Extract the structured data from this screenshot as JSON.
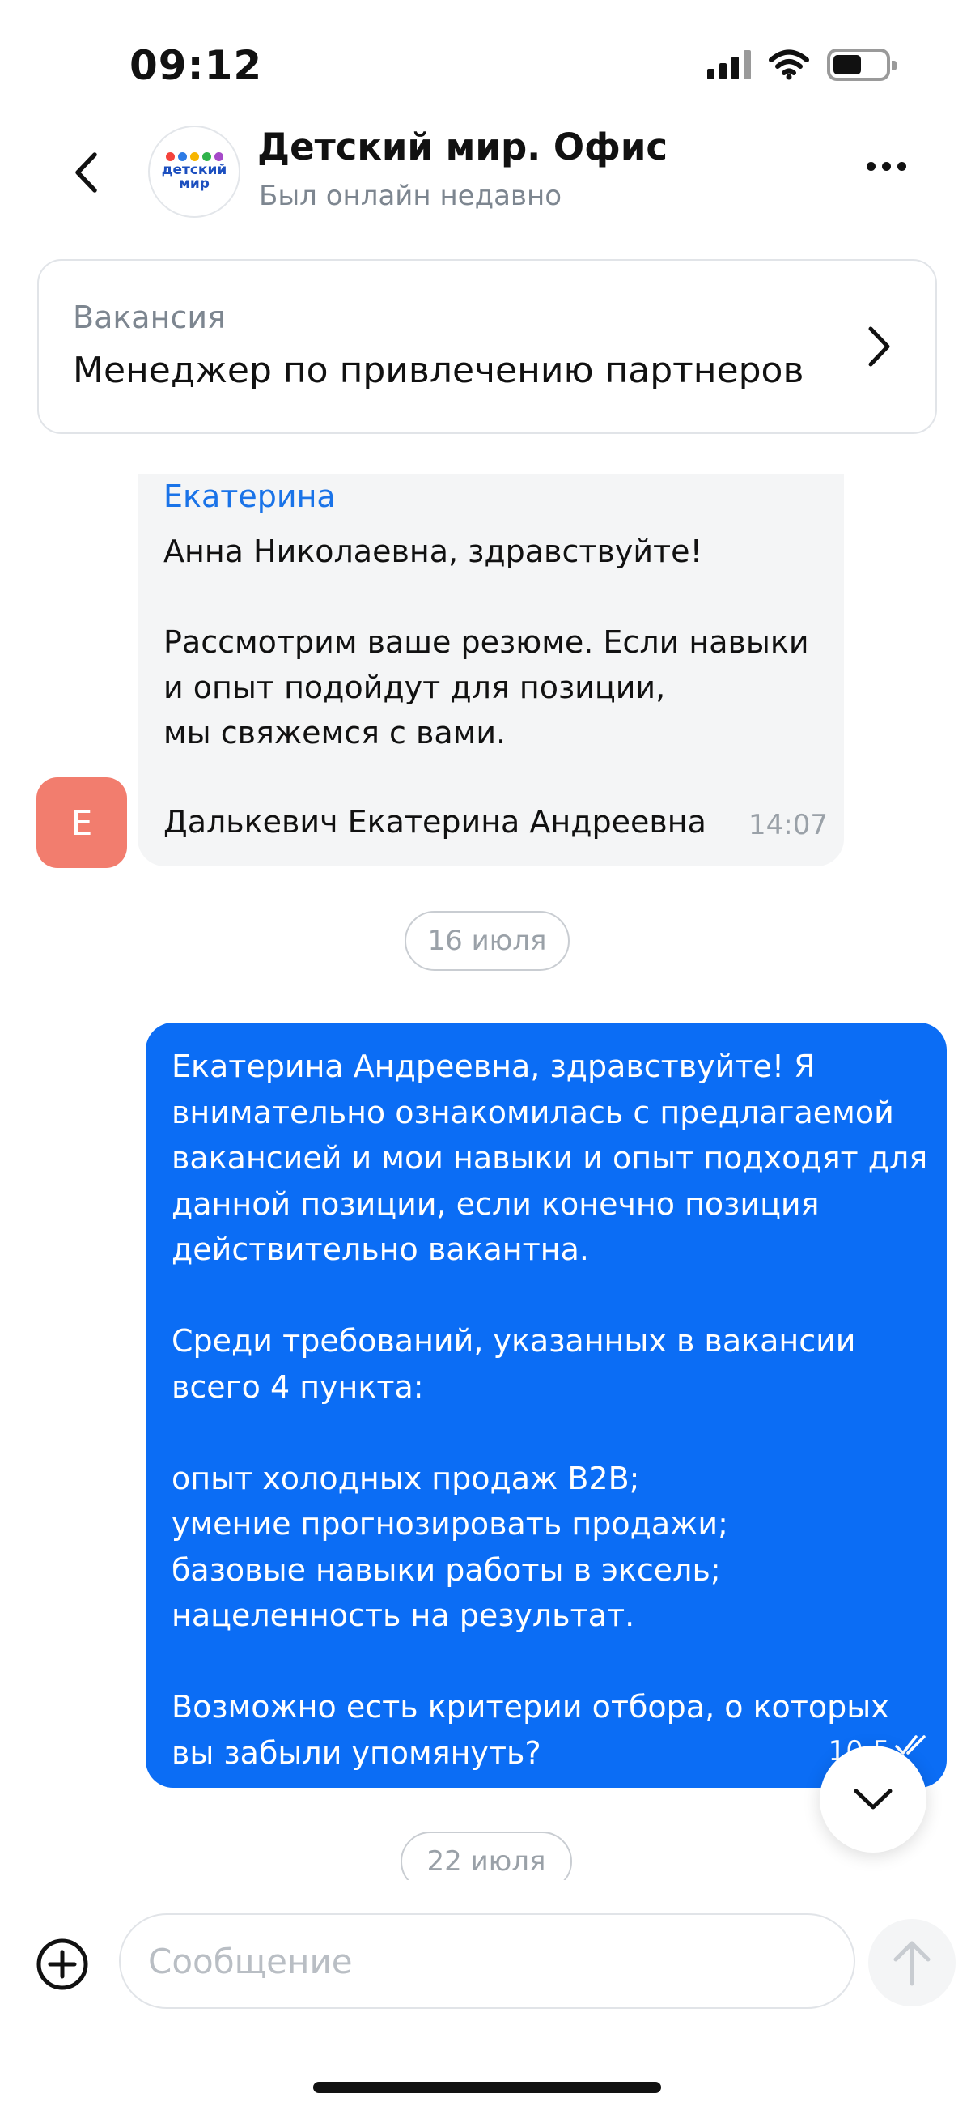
{
  "status_bar": {
    "time": "09:12",
    "icons": [
      "signal-icon",
      "wifi-icon",
      "battery-icon"
    ]
  },
  "header": {
    "title": "Детский мир. Офис",
    "subtitle": "Был онлайн недавно",
    "logo": {
      "text_line1": "детский",
      "text_line2": "мир",
      "dot_colors": [
        "#f4433c",
        "#2d7be5",
        "#f7b500",
        "#2fb34a",
        "#a64ac9"
      ]
    },
    "icons": [
      "back-icon",
      "more-icon"
    ]
  },
  "vacancy": {
    "label": "Вакансия",
    "title": "Менеджер по привлечению партнеров"
  },
  "messages": {
    "incoming": {
      "sender": "Екатерина",
      "avatar_letter": "Е",
      "avatar_color": "#f27d6e",
      "text": "Анна Николаевна, здравствуйте!\n\nРассмотрим ваше резюме. Если навыки\nи опыт подойдут для позиции,\nмы свяжемся с вами.",
      "signature": "Далькевич Екатерина Андреевна",
      "time": "14:07"
    },
    "date_1": "16 июля",
    "outgoing": {
      "text": "Екатерина Андреевна, здравствуйте! Я\nвнимательно ознакомилась с предлагаемой\nвакансией и мои навыки и опыт подходят для\nданной позиции, если конечно позиция\nдействительно вакантна.\n\nСреди требований, указанных в вакансии\nвсего 4 пункта:\n\nопыт холодных продаж B2B;\nумение прогнозировать продажи;\nбазовые навыки работы в эксель;\nнацеленность на результат.\n\nВозможно есть критерии отбора, о которых\nвы забыли упомянуть?",
      "time": "10:5",
      "bubble_color": "#0b6df5"
    },
    "date_2": "22 июля"
  },
  "composer": {
    "placeholder": "Сообщение",
    "value": ""
  },
  "colors": {
    "accent": "#0b6df5",
    "link": "#1a73e8",
    "muted": "#7d8690"
  }
}
